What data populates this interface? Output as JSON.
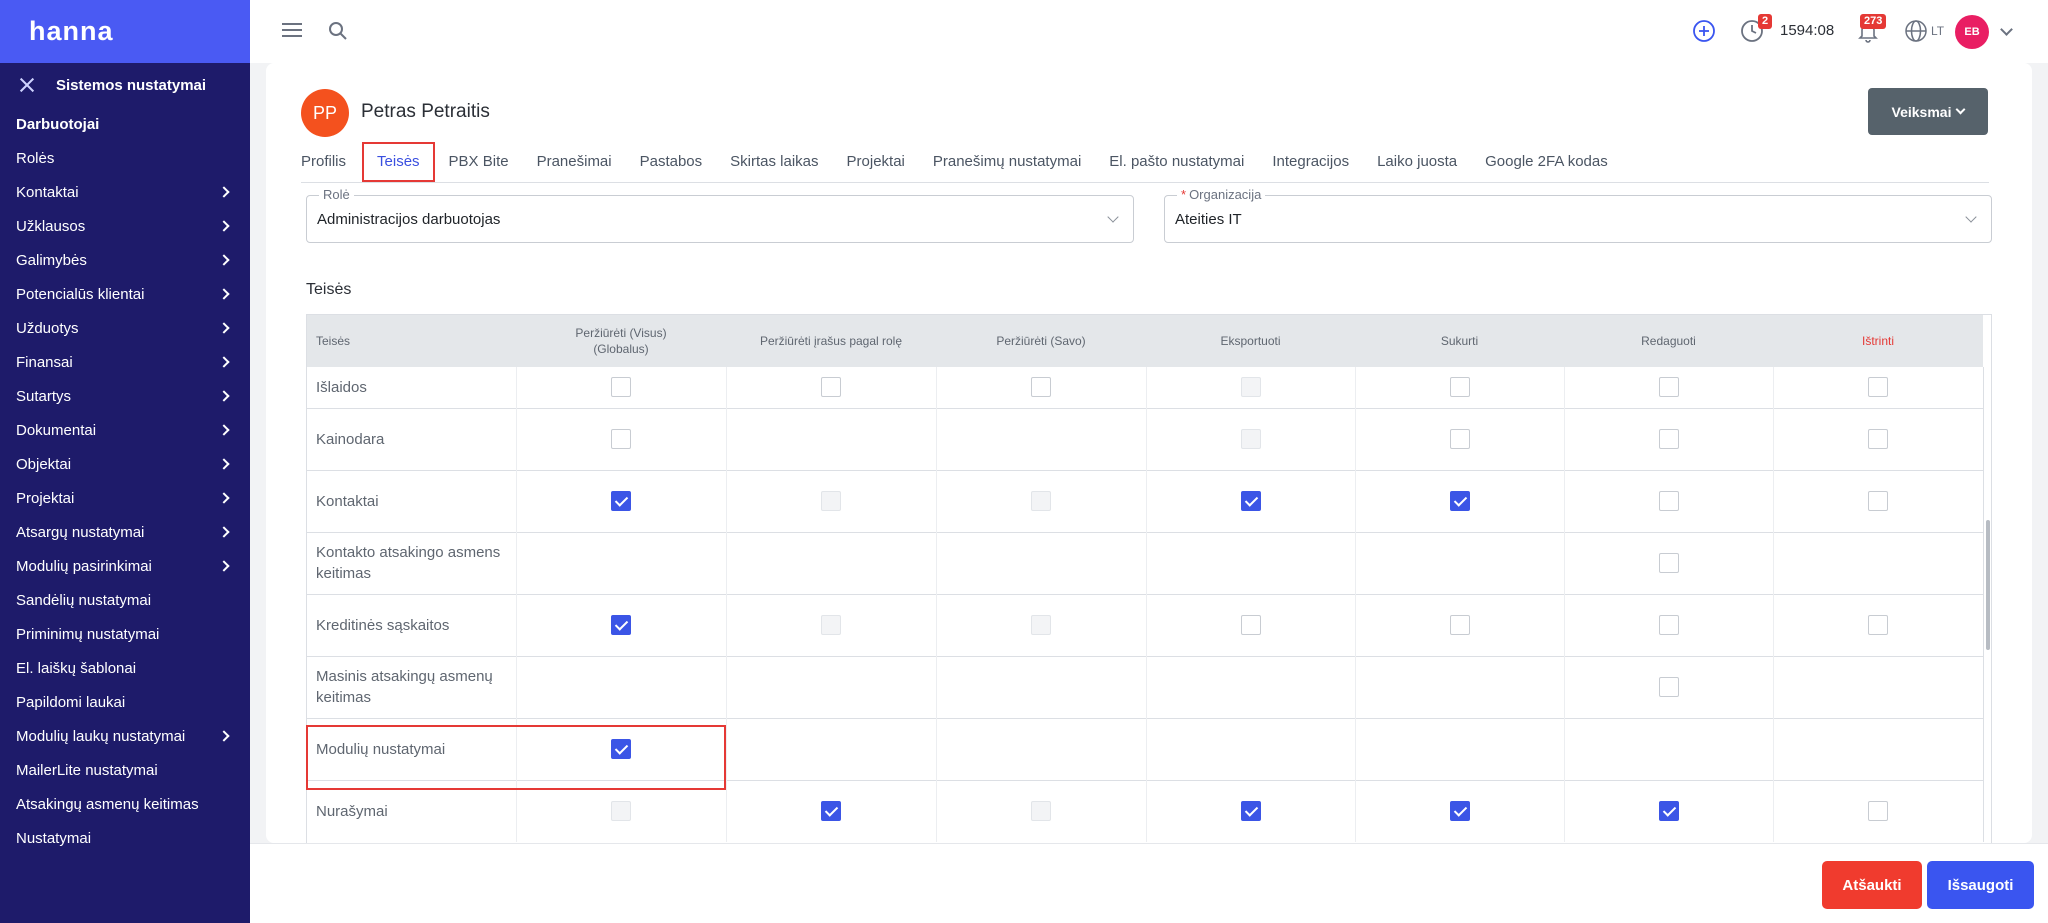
{
  "app": {
    "logo": "hanna"
  },
  "sidebar": {
    "header": "Sistemos nustatymai",
    "items": [
      {
        "label": "Darbuotojai",
        "active": true,
        "arrow": false
      },
      {
        "label": "Rolės",
        "arrow": false
      },
      {
        "label": "Kontaktai",
        "arrow": true
      },
      {
        "label": "Užklausos",
        "arrow": true
      },
      {
        "label": "Galimybės",
        "arrow": true
      },
      {
        "label": "Potencialūs klientai",
        "arrow": true
      },
      {
        "label": "Užduotys",
        "arrow": true
      },
      {
        "label": "Finansai",
        "arrow": true
      },
      {
        "label": "Sutartys",
        "arrow": true
      },
      {
        "label": "Dokumentai",
        "arrow": true
      },
      {
        "label": "Objektai",
        "arrow": true
      },
      {
        "label": "Projektai",
        "arrow": true
      },
      {
        "label": "Atsargų nustatymai",
        "arrow": true
      },
      {
        "label": "Modulių pasirinkimai",
        "arrow": true
      },
      {
        "label": "Sandėlių nustatymai",
        "arrow": false
      },
      {
        "label": "Priminimų nustatymai",
        "arrow": false
      },
      {
        "label": "El. laiškų šablonai",
        "arrow": false
      },
      {
        "label": "Papildomi laukai",
        "arrow": false
      },
      {
        "label": "Modulių laukų nustatymai",
        "arrow": true
      },
      {
        "label": "MailerLite nustatymai",
        "arrow": false
      },
      {
        "label": "Atsakingų asmenų keitimas",
        "arrow": false
      },
      {
        "label": "Nustatymai",
        "arrow": false
      }
    ]
  },
  "topbar": {
    "timer_badge": "2",
    "timer": "1594:08",
    "notifications_badge": "273",
    "language": "LT",
    "user_initials": "EB"
  },
  "profile": {
    "initials": "PP",
    "name": "Petras Petraitis",
    "actions_label": "Veiksmai"
  },
  "tabs": [
    {
      "label": "Profilis"
    },
    {
      "label": "Teisės",
      "active": true
    },
    {
      "label": "PBX Bite"
    },
    {
      "label": "Pranešimai"
    },
    {
      "label": "Pastabos"
    },
    {
      "label": "Skirtas laikas"
    },
    {
      "label": "Projektai"
    },
    {
      "label": "Pranešimų nustatymai"
    },
    {
      "label": "El. pašto nustatymai"
    },
    {
      "label": "Integracijos"
    },
    {
      "label": "Laiko juosta"
    },
    {
      "label": "Google 2FA kodas"
    }
  ],
  "form": {
    "role_label": "Rolė",
    "role_value": "Administracijos darbuotojas",
    "org_label": "Organizacija",
    "org_required": "*",
    "org_value": "Ateities IT"
  },
  "permissions": {
    "title": "Teisės",
    "columns": [
      {
        "label": "Teisės"
      },
      {
        "label": "Peržiūrėti (Visus) (Globalus)"
      },
      {
        "label": "Peržiūrėti įrašus pagal rolę"
      },
      {
        "label": "Peržiūrėti (Savo)"
      },
      {
        "label": "Eksportuoti"
      },
      {
        "label": "Sukurti"
      },
      {
        "label": "Redaguoti"
      },
      {
        "label": "Ištrinti",
        "danger": true
      }
    ],
    "rows": [
      {
        "name": "Išlaidos",
        "cells": [
          "empty",
          "empty",
          "empty",
          "disabled",
          "empty",
          "empty",
          "empty"
        ]
      },
      {
        "name": "Kainodara",
        "cells": [
          "empty",
          "none",
          "none",
          "disabled",
          "empty",
          "empty",
          "empty"
        ]
      },
      {
        "name": "Kontaktai",
        "cells": [
          "checked",
          "disabled",
          "disabled",
          "checked",
          "checked",
          "empty",
          "empty"
        ]
      },
      {
        "name": "Kontakto atsakingo asmens keitimas",
        "cells": [
          "none",
          "none",
          "none",
          "none",
          "none",
          "empty",
          "none"
        ]
      },
      {
        "name": "Kreditinės sąskaitos",
        "cells": [
          "checked",
          "disabled",
          "disabled",
          "empty",
          "empty",
          "empty",
          "empty"
        ]
      },
      {
        "name": "Masinis atsakingų asmenų keitimas",
        "cells": [
          "none",
          "none",
          "none",
          "none",
          "none",
          "empty",
          "none"
        ]
      },
      {
        "name": "Modulių nustatymai",
        "cells": [
          "checked",
          "none",
          "none",
          "none",
          "none",
          "none",
          "none"
        ]
      },
      {
        "name": "Nurašymai",
        "cells": [
          "disabled",
          "checked",
          "disabled",
          "checked",
          "checked",
          "checked",
          "empty"
        ]
      }
    ]
  },
  "footer": {
    "cancel_label": "Atšaukti",
    "save_label": "Išsaugoti"
  },
  "colors": {
    "sidebar": "#1e1b6a",
    "logo_bar": "#4a5af3",
    "accent": "#3b55e6",
    "danger": "#f03b2e"
  }
}
